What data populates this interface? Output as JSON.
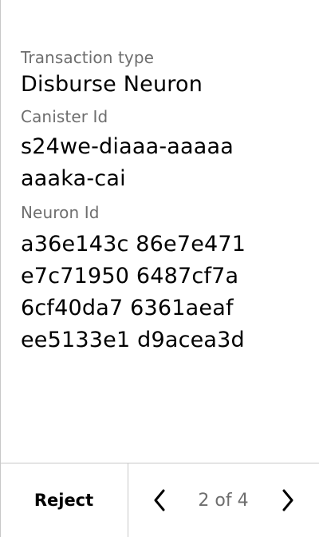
{
  "transaction": {
    "type_label": "Transaction type",
    "type_value": "Disburse Neuron",
    "canister_label": "Canister Id",
    "canister_lines": [
      "s24we-diaaa-aaaaa",
      "aaaka-cai"
    ],
    "neuron_label": "Neuron Id",
    "neuron_lines": [
      "a36e143c 86e7e471",
      "e7c71950 6487cf7a",
      "6cf40da7 6361aeaf",
      "ee5133e1 d9acea3d"
    ]
  },
  "footer": {
    "reject_label": "Reject",
    "page_indicator": "2 of 4",
    "prev_icon": "chevron-left-icon",
    "next_icon": "chevron-right-icon"
  },
  "colors": {
    "label_gray": "#6e6e6e",
    "text": "#000000",
    "border": "#c8c8c8",
    "background": "#ffffff"
  }
}
